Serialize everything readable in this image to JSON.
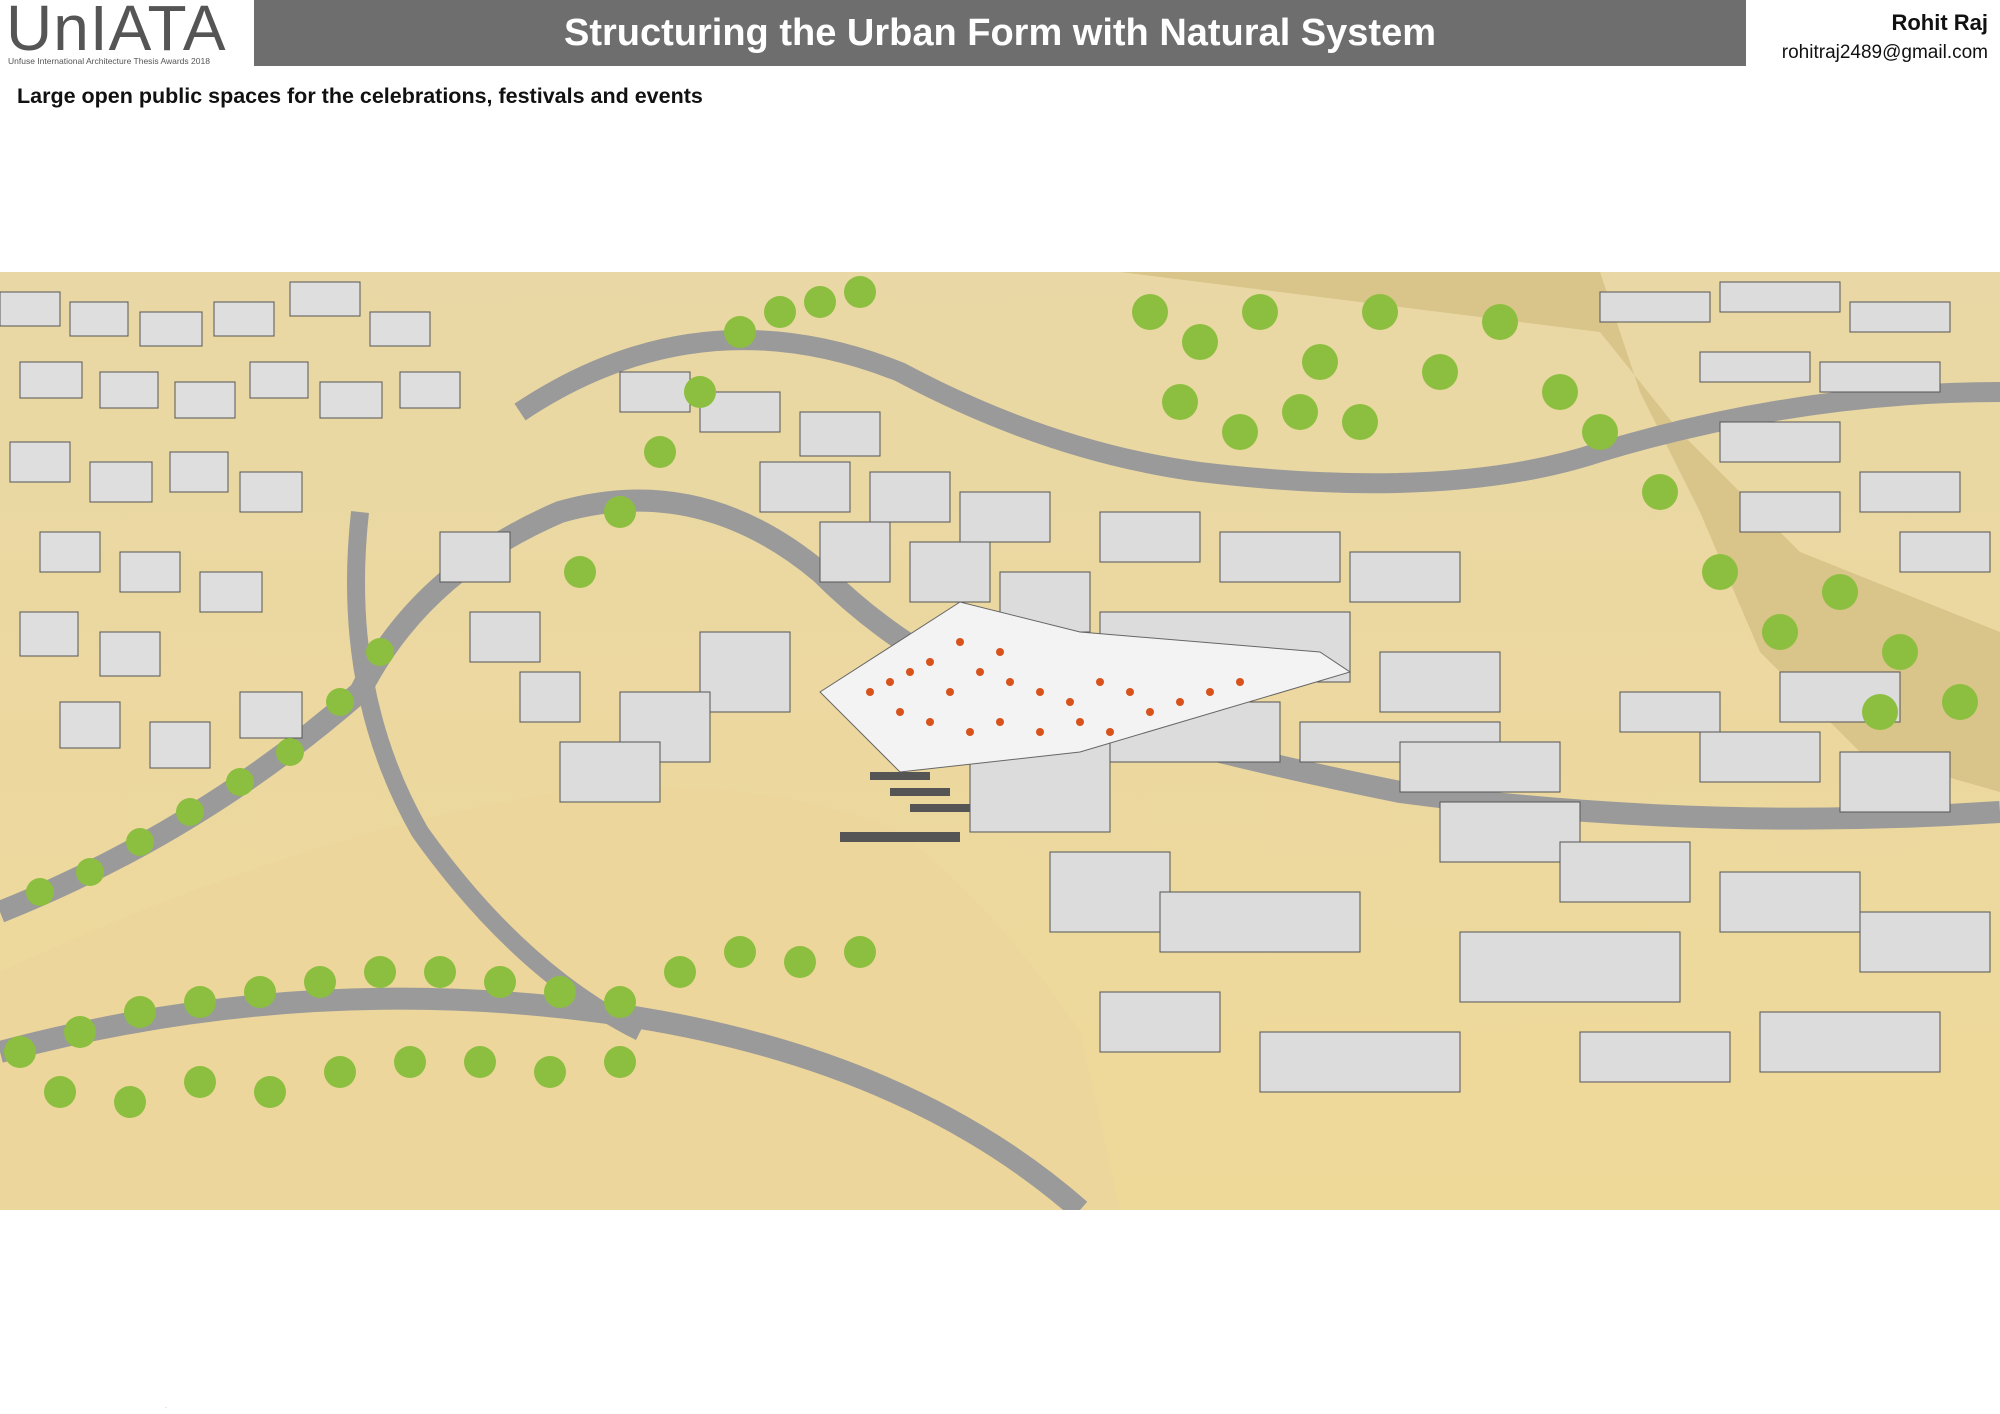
{
  "header": {
    "logo_text": "UnIATA",
    "logo_subtitle": "Unfuse International Architecture Thesis Awards 2018",
    "title": "Structuring the Urban Form with Natural System",
    "author_name": "Rohit Raj",
    "author_email": "rohitraj2489@gmail.com"
  },
  "main": {
    "subtitle": "Large open public spaces for the celebrations, festivals and events"
  },
  "illustration": {
    "description_icon": "aerial-3d-city-render",
    "colors": {
      "building": "#dcdcdc",
      "building_side": "#a9a9a9",
      "terrain": "#e8d49a",
      "road": "#9a9a9a",
      "tree": "#8cbf3f",
      "people": "#d8531c",
      "plaza": "#f2f2f2"
    }
  }
}
